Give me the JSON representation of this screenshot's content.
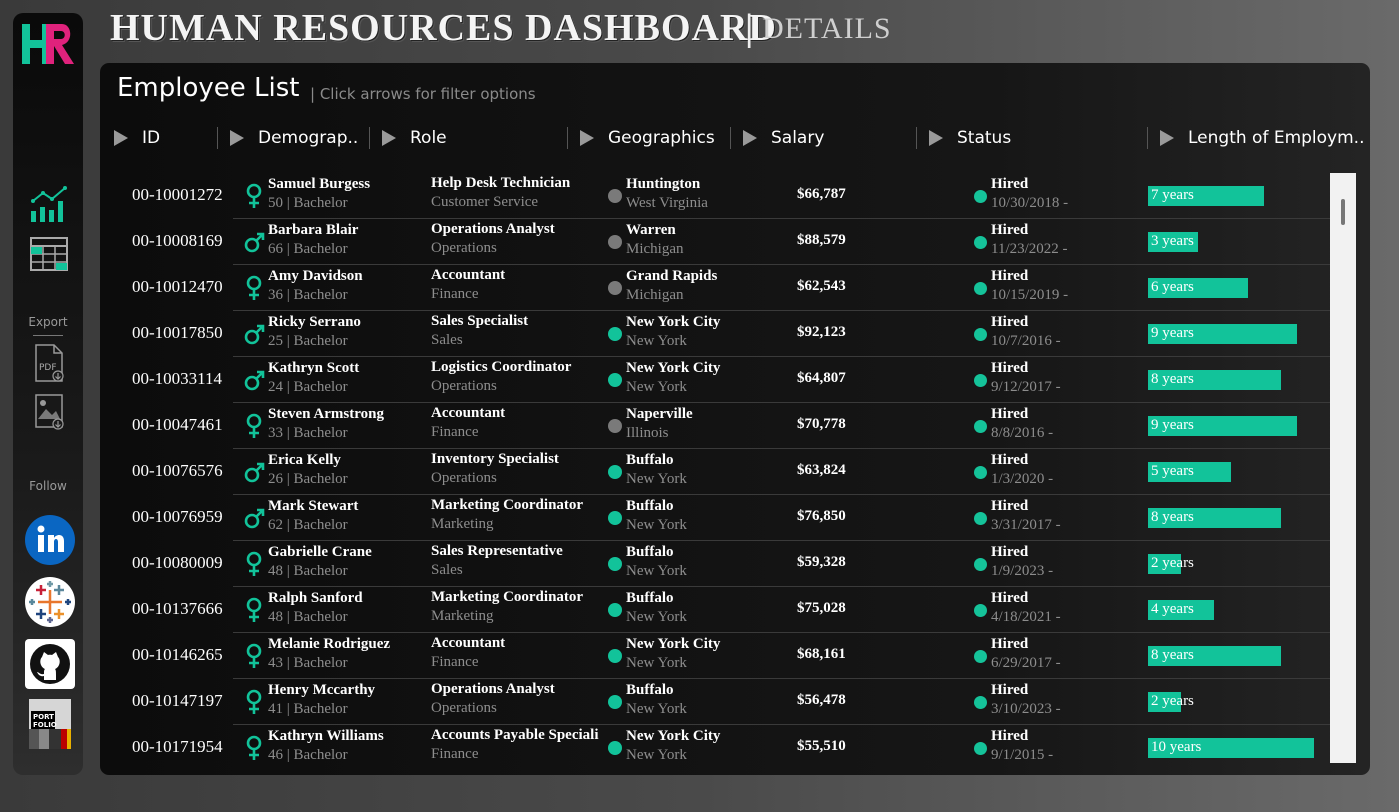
{
  "header": {
    "title": "HUMAN RESOURCES DASHBOARD",
    "separator": "|",
    "subtitle": "DETAILS"
  },
  "sidebar": {
    "logo_text": "HR",
    "export_label": "Export",
    "follow_label": "Follow",
    "icons": [
      "overview-chart-icon",
      "details-table-icon",
      "export-pdf-icon",
      "export-image-icon"
    ],
    "socials": [
      "linkedin-icon",
      "tableau-icon",
      "github-icon",
      "portfolio-icon"
    ],
    "portfolio_text": "PORT FOLIO"
  },
  "panel": {
    "title": "Employee List",
    "hint": "| Click arrows for filter options"
  },
  "columns": [
    "ID",
    "Demograp..",
    "Role",
    "Geographics",
    "Salary",
    "Status",
    "Length of Employm.."
  ],
  "colors": {
    "accent": "#12c39a",
    "hq_dot": "#12c39a",
    "branch_dot": "#7a7a7a"
  },
  "employees": [
    {
      "id": "00-10001272",
      "gender": "female",
      "name": "Samuel Burgess",
      "age_edu": "50 | Bachelor",
      "role": "Help Desk Technician",
      "dept": "Customer Service",
      "hq": false,
      "city": "Huntington",
      "state": "West Virginia",
      "salary": "$66,787",
      "status": "Hired",
      "date": "10/30/2018 -",
      "years": 7,
      "years_label": "7 years"
    },
    {
      "id": "00-10008169",
      "gender": "male",
      "name": "Barbara Blair",
      "age_edu": "66 | Bachelor",
      "role": "Operations Analyst",
      "dept": "Operations",
      "hq": false,
      "city": "Warren",
      "state": "Michigan",
      "salary": "$88,579",
      "status": "Hired",
      "date": "11/23/2022 -",
      "years": 3,
      "years_label": "3 years"
    },
    {
      "id": "00-10012470",
      "gender": "female",
      "name": "Amy Davidson",
      "age_edu": "36 | Bachelor",
      "role": "Accountant",
      "dept": "Finance",
      "hq": false,
      "city": "Grand Rapids",
      "state": "Michigan",
      "salary": "$62,543",
      "status": "Hired",
      "date": "10/15/2019 -",
      "years": 6,
      "years_label": "6 years"
    },
    {
      "id": "00-10017850",
      "gender": "male",
      "name": "Ricky Serrano",
      "age_edu": "25 | Bachelor",
      "role": "Sales Specialist",
      "dept": "Sales",
      "hq": true,
      "city": "New York City",
      "state": "New York",
      "salary": "$92,123",
      "status": "Hired",
      "date": "10/7/2016 -",
      "years": 9,
      "years_label": "9 years"
    },
    {
      "id": "00-10033114",
      "gender": "male",
      "name": "Kathryn Scott",
      "age_edu": "24 | Bachelor",
      "role": "Logistics Coordinator",
      "dept": "Operations",
      "hq": true,
      "city": "New York City",
      "state": "New York",
      "salary": "$64,807",
      "status": "Hired",
      "date": "9/12/2017 -",
      "years": 8,
      "years_label": "8 years"
    },
    {
      "id": "00-10047461",
      "gender": "female",
      "name": "Steven Armstrong",
      "age_edu": "33 | Bachelor",
      "role": "Accountant",
      "dept": "Finance",
      "hq": false,
      "city": "Naperville",
      "state": "Illinois",
      "salary": "$70,778",
      "status": "Hired",
      "date": "8/8/2016 -",
      "years": 9,
      "years_label": "9 years"
    },
    {
      "id": "00-10076576",
      "gender": "male",
      "name": "Erica Kelly",
      "age_edu": "26 | Bachelor",
      "role": "Inventory Specialist",
      "dept": "Operations",
      "hq": true,
      "city": "Buffalo",
      "state": "New York",
      "salary": "$63,824",
      "status": "Hired",
      "date": "1/3/2020 -",
      "years": 5,
      "years_label": "5 years"
    },
    {
      "id": "00-10076959",
      "gender": "male",
      "name": "Mark Stewart",
      "age_edu": "62 | Bachelor",
      "role": "Marketing Coordinator",
      "dept": "Marketing",
      "hq": true,
      "city": "Buffalo",
      "state": "New York",
      "salary": "$76,850",
      "status": "Hired",
      "date": "3/31/2017 -",
      "years": 8,
      "years_label": "8 years"
    },
    {
      "id": "00-10080009",
      "gender": "female",
      "name": "Gabrielle Crane",
      "age_edu": "48 | Bachelor",
      "role": "Sales Representative",
      "dept": "Sales",
      "hq": true,
      "city": "Buffalo",
      "state": "New York",
      "salary": "$59,328",
      "status": "Hired",
      "date": "1/9/2023 -",
      "years": 2,
      "years_label": "2 years"
    },
    {
      "id": "00-10137666",
      "gender": "female",
      "name": "Ralph Sanford",
      "age_edu": "48 | Bachelor",
      "role": "Marketing Coordinator",
      "dept": "Marketing",
      "hq": true,
      "city": "Buffalo",
      "state": "New York",
      "salary": "$75,028",
      "status": "Hired",
      "date": "4/18/2021 -",
      "years": 4,
      "years_label": "4 years"
    },
    {
      "id": "00-10146265",
      "gender": "female",
      "name": "Melanie Rodriguez",
      "age_edu": "43 | Bachelor",
      "role": "Accountant",
      "dept": "Finance",
      "hq": true,
      "city": "New York City",
      "state": "New York",
      "salary": "$68,161",
      "status": "Hired",
      "date": "6/29/2017 -",
      "years": 8,
      "years_label": "8 years"
    },
    {
      "id": "00-10147197",
      "gender": "female",
      "name": "Henry Mccarthy",
      "age_edu": "41 | Bachelor",
      "role": "Operations Analyst",
      "dept": "Operations",
      "hq": true,
      "city": "Buffalo",
      "state": "New York",
      "salary": "$56,478",
      "status": "Hired",
      "date": "3/10/2023 -",
      "years": 2,
      "years_label": "2 years"
    },
    {
      "id": "00-10171954",
      "gender": "female",
      "name": "Kathryn Williams",
      "age_edu": "46 | Bachelor",
      "role": "Accounts Payable Specialist",
      "dept": "Finance",
      "hq": true,
      "city": "New York City",
      "state": "New York",
      "salary": "$55,510",
      "status": "Hired",
      "date": "9/1/2015 -",
      "years": 10,
      "years_label": "10 years"
    }
  ]
}
